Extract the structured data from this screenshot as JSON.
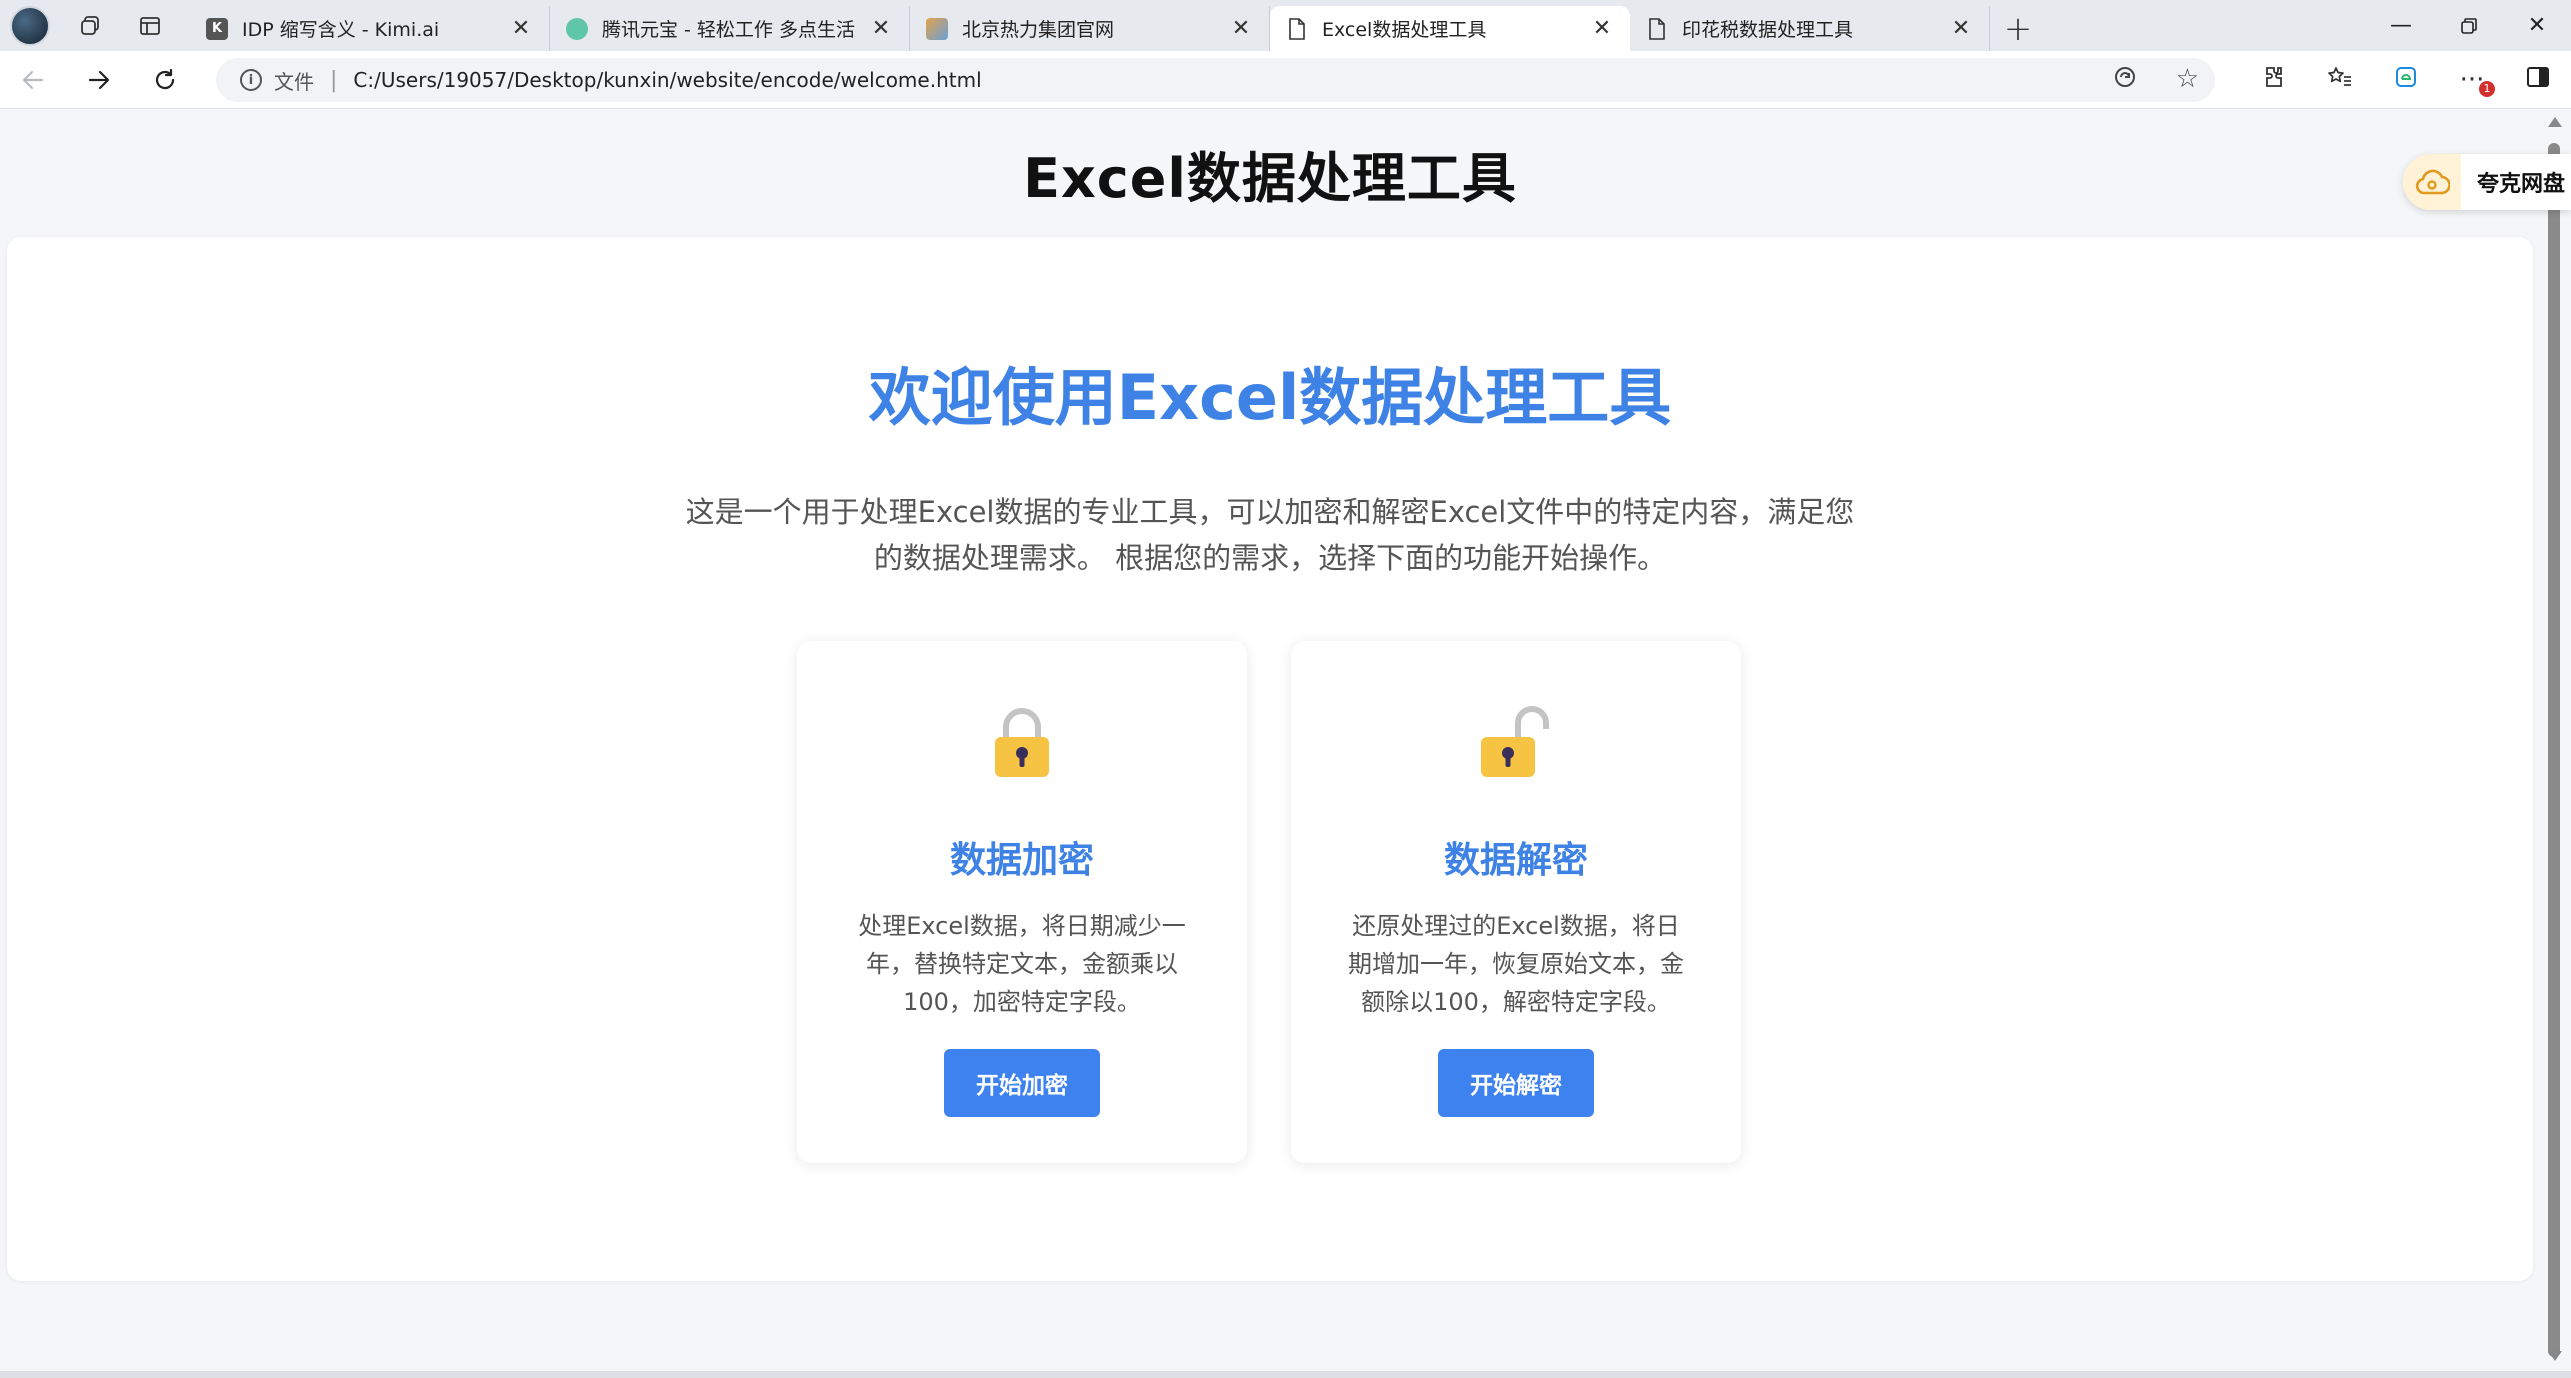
{
  "browser": {
    "tabs": [
      {
        "title": "IDP 缩写含义 - Kimi.ai",
        "favicon_color": "#555555",
        "favicon_letter": "K",
        "active": false
      },
      {
        "title": "腾讯元宝 - 轻松工作 多点生活",
        "favicon_color": "#5fc7a8",
        "favicon_letter": "",
        "active": false
      },
      {
        "title": "北京热力集团官网",
        "favicon_color": "#e3a24a",
        "favicon_letter": "",
        "active": false
      },
      {
        "title": "Excel数据处理工具",
        "favicon_color": "#ffffff",
        "favicon_letter": "",
        "active": true
      },
      {
        "title": "印花税数据处理工具",
        "favicon_color": "#ffffff",
        "favicon_letter": "",
        "active": false
      }
    ],
    "omnibox": {
      "label": "文件",
      "separator": "|",
      "url": "C:/Users/19057/Desktop/kunxin/website/encode/welcome.html"
    },
    "notification_count": "1"
  },
  "page": {
    "header_title": "Excel数据处理工具",
    "welcome_title": "欢迎使用Excel数据处理工具",
    "welcome_desc": "这是一个用于处理Excel数据的专业工具，可以加密和解密Excel文件中的特定内容，满足您的数据处理需求。 根据您的需求，选择下面的功能开始操作。",
    "features": [
      {
        "icon": "lock-icon",
        "title": "数据加密",
        "description": "处理Excel数据，将日期减少一年，替换特定文本，金额乘以100，加密特定字段。",
        "button": "开始加密"
      },
      {
        "icon": "unlock-icon",
        "title": "数据解密",
        "description": "还原处理过的Excel数据，将日期增加一年，恢复原始文本，金额除以100，解密特定字段。",
        "button": "开始解密"
      }
    ]
  },
  "quark_widget": {
    "label": "夸克网盘"
  },
  "colors": {
    "accent": "#3e82e6",
    "button": "#3e82f0",
    "lock_body": "#f6c343",
    "lock_shackle": "#c4c4c4"
  }
}
